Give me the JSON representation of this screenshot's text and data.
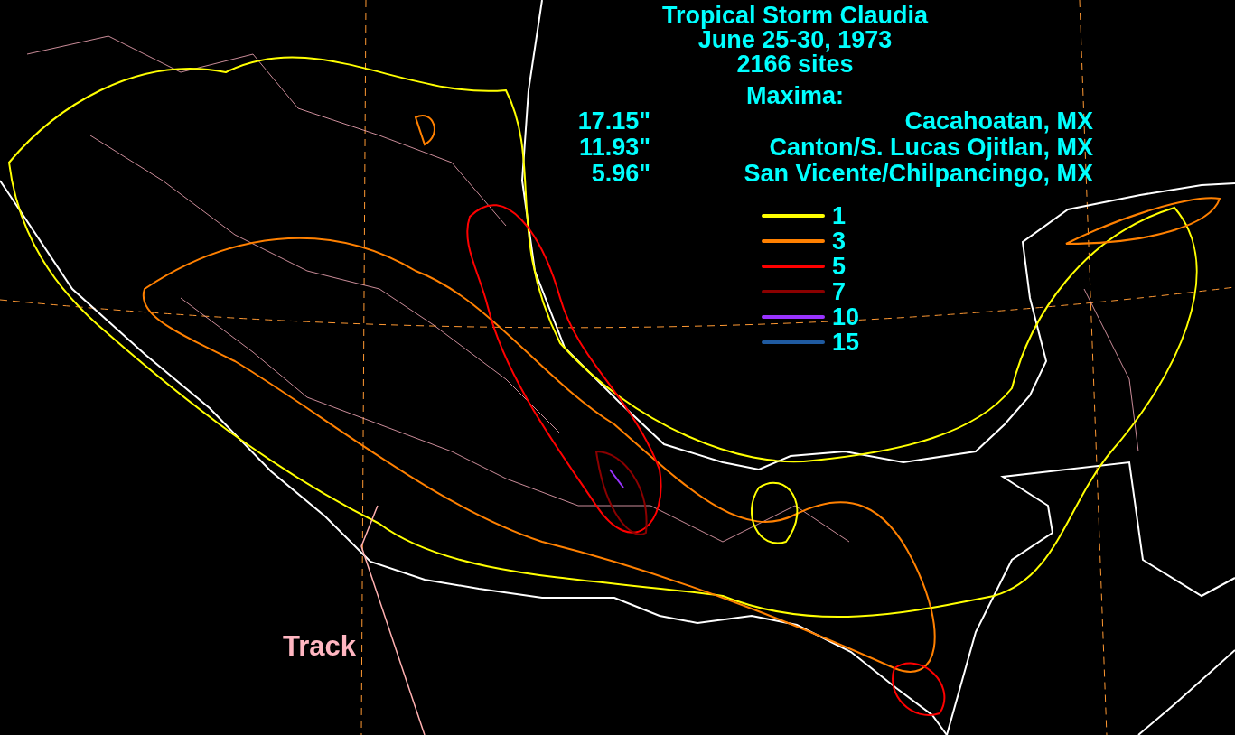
{
  "title_lines": [
    "Tropical Storm Claudia",
    "June 25-30, 1973",
    "2166 sites"
  ],
  "maxima_heading": "Maxima:",
  "maxima": [
    {
      "amount": "17.15\"",
      "location": "Cacahoatan, MX"
    },
    {
      "amount": "11.93\"",
      "location": "Canton/S. Lucas Ojitlan, MX"
    },
    {
      "amount": "5.96\"",
      "location": "San Vicente/Chilpancingo, MX"
    }
  ],
  "legend": [
    {
      "value": "1",
      "color": "#ffff00"
    },
    {
      "value": "3",
      "color": "#ff8000"
    },
    {
      "value": "5",
      "color": "#ff0000"
    },
    {
      "value": "7",
      "color": "#8b0000"
    },
    {
      "value": "10",
      "color": "#9933ff"
    },
    {
      "value": "15",
      "color": "#1f5aa0"
    }
  ],
  "track_label": "Track"
}
